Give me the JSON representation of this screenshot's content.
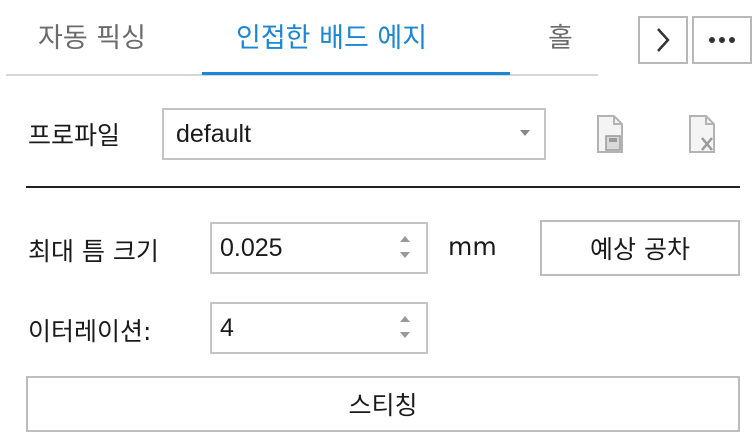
{
  "tabs": [
    {
      "label": "자동 픽싱",
      "active": false
    },
    {
      "label": "인접한 배드 에지",
      "active": true
    },
    {
      "label": "홀",
      "active": false
    }
  ],
  "nav": {
    "next_icon": "chevron-right-icon",
    "more_icon": "ellipsis-icon"
  },
  "profile": {
    "label": "프로파일",
    "value": "default",
    "icons": [
      "profile-save-icon",
      "profile-delete-icon"
    ]
  },
  "max_gap": {
    "label": "최대 틈 크기",
    "value": "0.025",
    "unit": "mm"
  },
  "expected_tolerance_button": "예상 공차",
  "iterations": {
    "label": "이터레이션:",
    "value": "4"
  },
  "stitch_button": "스티칭",
  "colors": {
    "accent": "#1a86d6",
    "border": "#c4c4c4",
    "text": "#1a1a1a",
    "inactive_tab": "#6b6b6b"
  }
}
